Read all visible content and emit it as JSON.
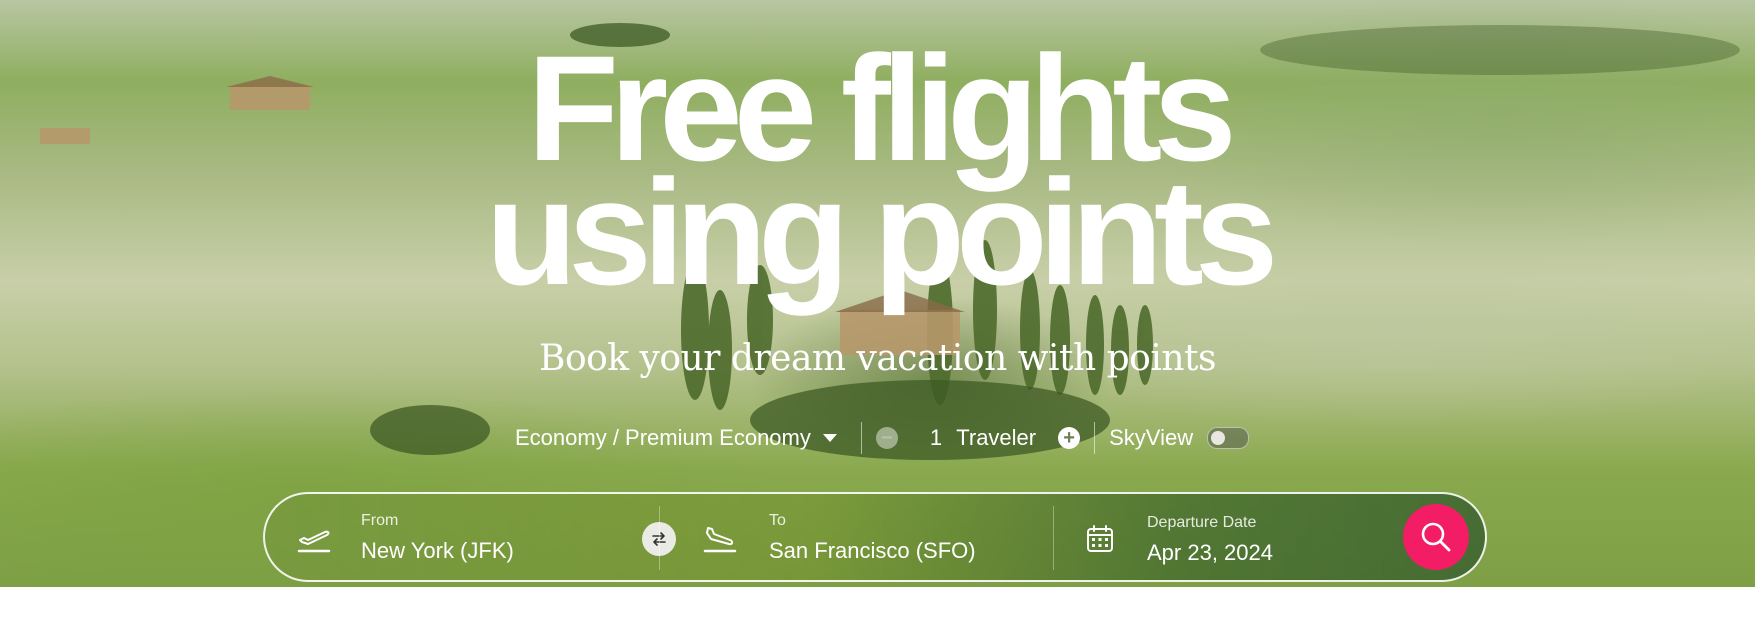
{
  "hero": {
    "headline_line1": "Free flights",
    "headline_line2": "using points",
    "subtitle": "Book your dream vacation with points"
  },
  "options": {
    "cabin_class": "Economy / Premium Economy",
    "traveler_count": "1",
    "traveler_label": "Traveler",
    "skyview_label": "SkyView",
    "skyview_enabled": false
  },
  "search": {
    "from_label": "From",
    "from_value": "New York (JFK)",
    "to_label": "To",
    "to_value": "San Francisco (SFO)",
    "date_label": "Departure Date",
    "date_value": "Apr 23, 2024"
  },
  "colors": {
    "search_button": "#f21d64",
    "text": "#ffffff"
  },
  "icons": [
    "takeoff-icon",
    "swap-icon",
    "landing-icon",
    "calendar-icon",
    "search-icon",
    "chevron-down-icon",
    "minus-icon",
    "plus-icon"
  ]
}
